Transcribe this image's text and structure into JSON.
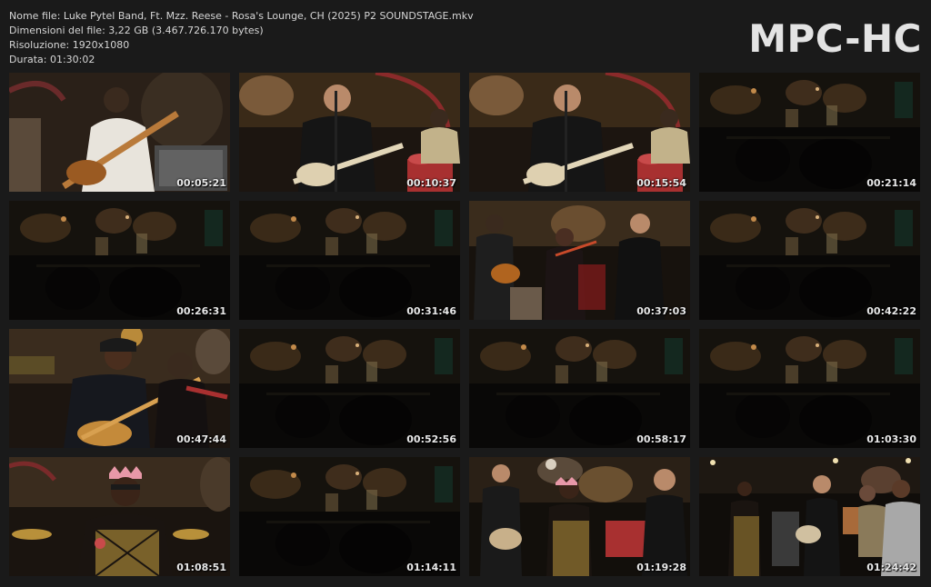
{
  "header": {
    "file_name": "Nome file: Luke Pytel Band, Ft. Mzz. Reese - Rosa's Lounge, CH (2025) P2 SOUNDSTAGE.mkv",
    "file_size": "Dimensioni del file: 3,22 GB (3.467.726.170 bytes)",
    "resolution": "Risoluzione: 1920x1080",
    "duration": "Durata: 01:30:02"
  },
  "logo": "MPC-HC",
  "thumbnails": [
    {
      "time": "00:05:21",
      "scene": "closeup-guitarist-white"
    },
    {
      "time": "00:10:37",
      "scene": "guitarist-black-drums"
    },
    {
      "time": "00:15:54",
      "scene": "guitarist-black-drums"
    },
    {
      "time": "00:21:14",
      "scene": "wide-dark"
    },
    {
      "time": "00:26:31",
      "scene": "wide-dark"
    },
    {
      "time": "00:31:46",
      "scene": "wide-dark"
    },
    {
      "time": "00:37:03",
      "scene": "trio-violin"
    },
    {
      "time": "00:42:22",
      "scene": "wide-dark"
    },
    {
      "time": "00:47:44",
      "scene": "closeup-duo"
    },
    {
      "time": "00:52:56",
      "scene": "wide-dark"
    },
    {
      "time": "00:58:17",
      "scene": "wide-dark"
    },
    {
      "time": "01:03:30",
      "scene": "wide-dark"
    },
    {
      "time": "01:08:51",
      "scene": "singer-crown"
    },
    {
      "time": "01:14:11",
      "scene": "wide-dark"
    },
    {
      "time": "01:19:28",
      "scene": "band-singer"
    },
    {
      "time": "01:24:42",
      "scene": "band-wide-lit"
    }
  ]
}
